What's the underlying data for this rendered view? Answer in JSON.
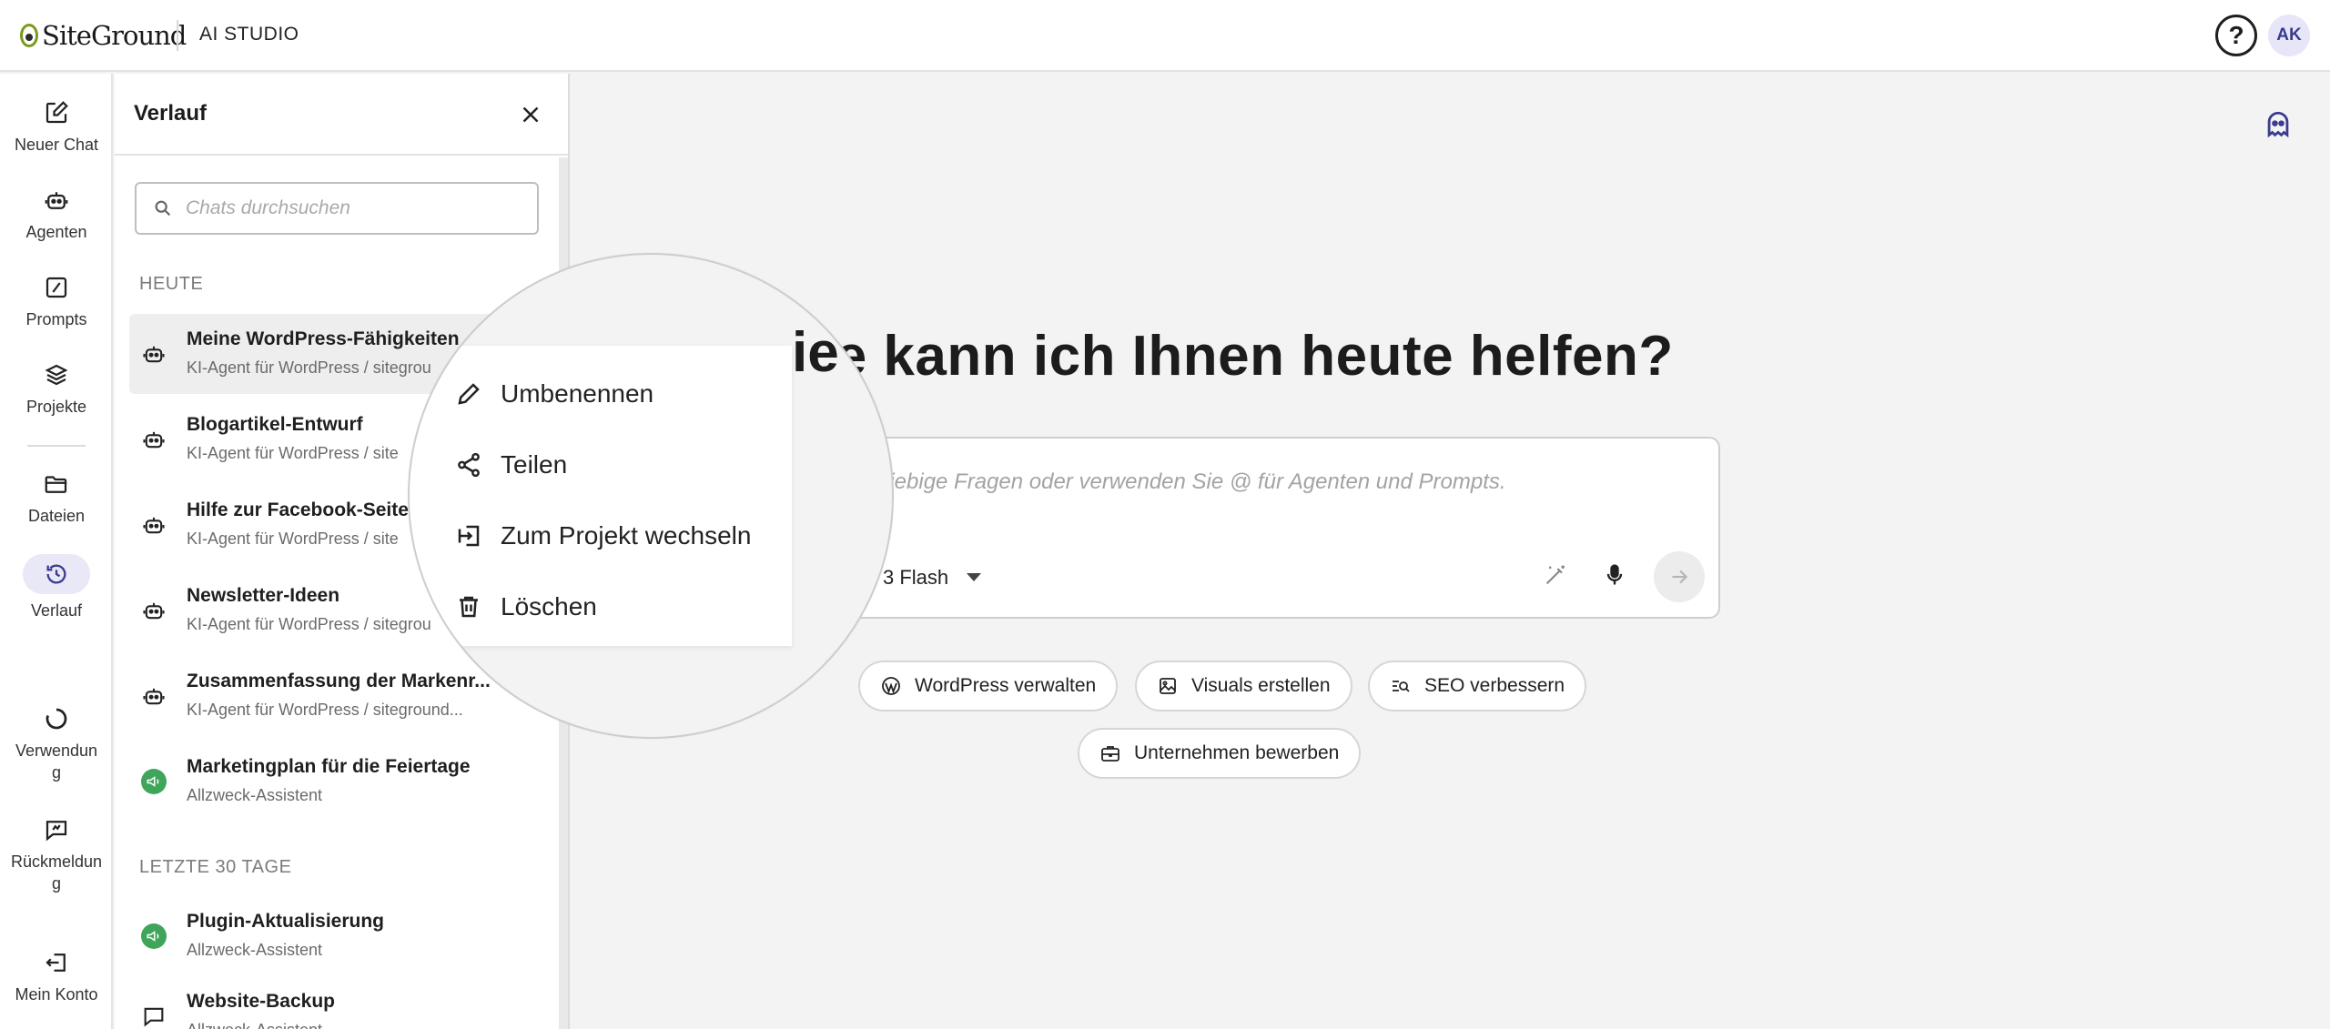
{
  "topbar": {
    "brand": "SiteGround",
    "product": "AI STUDIO",
    "help_symbol": "?",
    "avatar_initials": "AK"
  },
  "rail": {
    "items": [
      {
        "label": "Neuer Chat",
        "icon": "edit-icon"
      },
      {
        "label": "Agenten",
        "icon": "robot-icon"
      },
      {
        "label": "Prompts",
        "icon": "prompt-icon"
      },
      {
        "label": "Projekte",
        "icon": "layers-icon"
      },
      {
        "label": "Dateien",
        "icon": "folder-icon"
      },
      {
        "label": "Verlauf",
        "icon": "history-icon",
        "active": true
      },
      {
        "label": "Verwendung",
        "icon": "usage-icon"
      },
      {
        "label": "Rückmeldung",
        "icon": "feedback-icon"
      },
      {
        "label": "Mein Konto",
        "icon": "logout-icon"
      }
    ],
    "labels_wrapped": {
      "verwendung_1": "Verwendun",
      "verwendung_2": "g",
      "rueckmeldung_1": "Rückmeldun",
      "rueckmeldung_2": "g"
    }
  },
  "history": {
    "title": "Verlauf",
    "search_placeholder": "Chats durchsuchen",
    "sections": {
      "today": "HEUTE",
      "last30": "LETZTE 30 TAGE"
    },
    "today_items": [
      {
        "title": "Meine WordPress-Fähigkeiten",
        "sub": "KI-Agent für WordPress   /   sitegrou"
      },
      {
        "title": "Blogartikel-Entwurf",
        "sub": "KI-Agent für WordPress   /   site"
      },
      {
        "title": "Hilfe zur Facebook-Seite",
        "sub": "KI-Agent für WordPress   /   site"
      },
      {
        "title": "Newsletter-Ideen",
        "sub": "KI-Agent für WordPress   /   sitegrou"
      },
      {
        "title": "Zusammenfassung der Markenr...",
        "sub": "KI-Agent für WordPress   /   siteground..."
      },
      {
        "title": "Marketingplan für die Feiertage",
        "sub": "Allzweck-Assistent"
      }
    ],
    "last30_items": [
      {
        "title": "Plugin-Aktualisierung",
        "sub": "Allzweck-Assistent"
      },
      {
        "title": "Website-Backup",
        "sub": "Allzweck-Assistent"
      }
    ]
  },
  "context_menu": {
    "items": [
      {
        "label": "Umbenennen",
        "icon": "pencil-icon"
      },
      {
        "label": "Teilen",
        "icon": "share-icon"
      },
      {
        "label": "Zum Projekt wechseln",
        "icon": "move-to-project-icon"
      },
      {
        "label": "Löschen",
        "icon": "trash-icon"
      }
    ],
    "magnified_headline_fragment": "ie kann ich Ihnen heute helfen?"
  },
  "main": {
    "headline": "ie kann ich Ihnen heute helfen?",
    "composer_placeholder": "liebige Fragen oder verwenden Sie @ für Agenten und Prompts.",
    "model": "3 Flash",
    "chips": [
      {
        "label": "WordPress verwalten",
        "icon": "wordpress-icon"
      },
      {
        "label": "Visuals erstellen",
        "icon": "image-icon"
      },
      {
        "label": "SEO verbessern",
        "icon": "seo-search-icon"
      },
      {
        "label": "Unternehmen bewerben",
        "icon": "briefcase-icon"
      }
    ]
  },
  "colors": {
    "accent": "#3b3b8f",
    "active_bg": "#e8e8f7",
    "green_badge": "#3ea55b",
    "background": "#f3f3f3"
  }
}
